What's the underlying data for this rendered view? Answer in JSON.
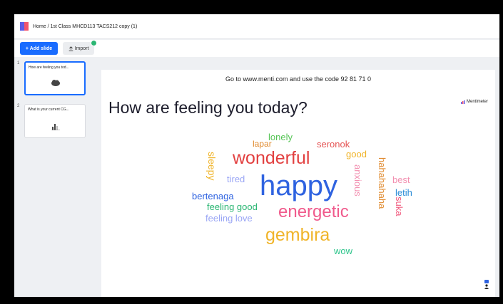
{
  "topbar": {
    "breadcrumb": "Home / 1st Class MHCD113 TACS212 copy (1)"
  },
  "toolbar": {
    "add_slide_label": "+ Add slide",
    "import_label": "Import"
  },
  "sidebar": {
    "slides": [
      {
        "number": "1",
        "title": "How are feeling you tod..."
      },
      {
        "number": "2",
        "title": "What is your current CG..."
      }
    ]
  },
  "stage": {
    "join_instruction": "Go to www.menti.com and use the code 92 81 71 0",
    "question": "How are feeling you today?",
    "brand_name": "Mentimeter"
  },
  "wordcloud": {
    "words": [
      {
        "text": "lonely",
        "color": "#53c453"
      },
      {
        "text": "lapar",
        "color": "#e08a2e"
      },
      {
        "text": "seronok",
        "color": "#e55555"
      },
      {
        "text": "wonderful",
        "color": "#e23f3f"
      },
      {
        "text": "good",
        "color": "#f0b429"
      },
      {
        "text": "sleepy",
        "color": "#f0b429"
      },
      {
        "text": "tired",
        "color": "#9aa6f5"
      },
      {
        "text": "anxious",
        "color": "#f28fb0"
      },
      {
        "text": "hahahahaha",
        "color": "#e08a2e"
      },
      {
        "text": "best",
        "color": "#f28fb0"
      },
      {
        "text": "happy",
        "color": "#2f63e0"
      },
      {
        "text": "letih",
        "color": "#2a8bd6"
      },
      {
        "text": "bertenaga",
        "color": "#2f63e0"
      },
      {
        "text": "feeling good",
        "color": "#2bb673"
      },
      {
        "text": "suka",
        "color": "#f05a7e"
      },
      {
        "text": "energetic",
        "color": "#f05a8c"
      },
      {
        "text": "feeling love",
        "color": "#9aa6f5"
      },
      {
        "text": "gembira",
        "color": "#f0b429"
      },
      {
        "text": "wow",
        "color": "#2bc48a"
      }
    ]
  }
}
